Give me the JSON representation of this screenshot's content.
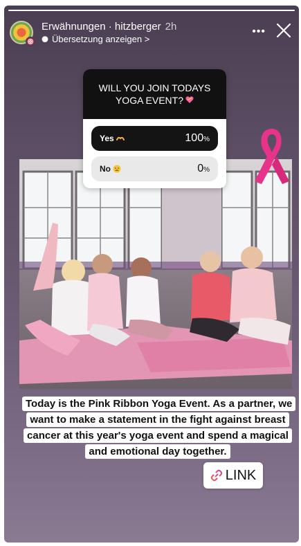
{
  "header": {
    "account": "Erwähnungen · hitzberger",
    "time": "2h",
    "translate_label": "Übersetzung anzeigen >",
    "more_label": "•••"
  },
  "story_progress": 1.0,
  "poll": {
    "question": "WILL YOU JOIN TODAYS YOGA EVENT?",
    "options": [
      {
        "label": "Yes",
        "percent": "100",
        "unit": "%"
      },
      {
        "label": "No",
        "percent": "0",
        "unit": "%"
      }
    ]
  },
  "caption": "Today is the Pink Ribbon Yoga Event. As a partner, we want to make a statement in the fight against breast cancer at this year's yoga event and spend a magical and emotional day together.",
  "link_sticker": {
    "label": "LINK"
  },
  "colors": {
    "ribbon": "#e8338a",
    "poll_dark": "#111111",
    "link_icon_start": "#ff6a2c",
    "link_icon_end": "#c833c8"
  },
  "icons": [
    "avatar-badge-icon",
    "translate-bubble-icon",
    "more-icon",
    "close-icon",
    "pink-ribbon-icon",
    "link-icon",
    "hands-emoji-icon",
    "sad-face-emoji-icon",
    "heart-emoji-icon"
  ]
}
